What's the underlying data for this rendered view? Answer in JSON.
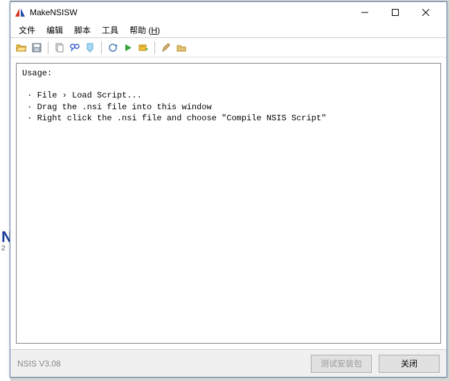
{
  "bg": {
    "letter": "N",
    "num": "2"
  },
  "window": {
    "title": "MakeNSISW",
    "menu": {
      "file": "文件",
      "edit": "编辑",
      "script": "脚本",
      "tools": "工具",
      "help_prefix": "帮助 (",
      "help_key": "H",
      "help_suffix": ")"
    },
    "output": "Usage:\n\n · File › Load Script...\n · Drag the .nsi file into this window\n · Right click the .nsi file and choose \"Compile NSIS Script\"",
    "status": {
      "version": "NSIS V3.08",
      "test_btn": "测试安装包",
      "close_btn": "关闭"
    }
  }
}
